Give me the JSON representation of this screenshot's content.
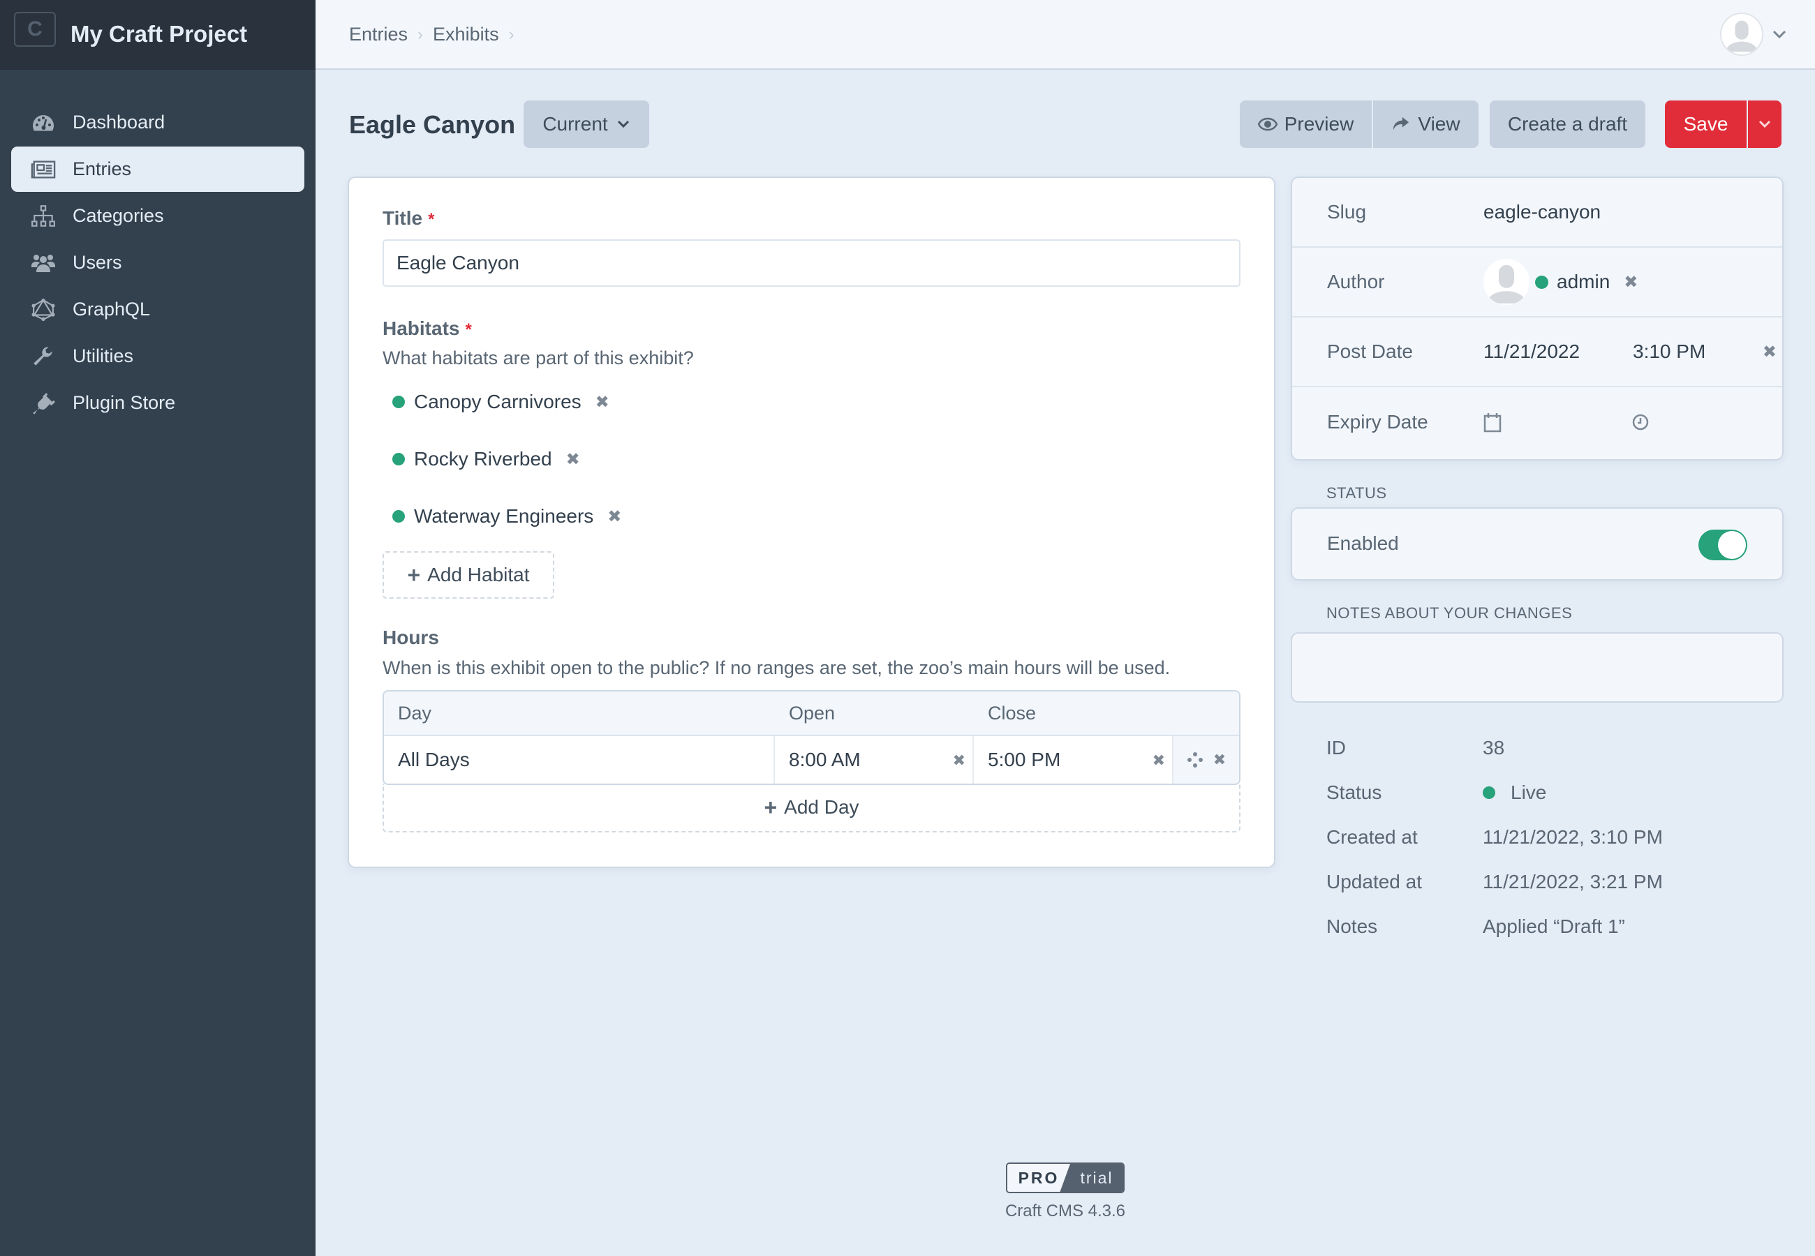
{
  "app": {
    "site_name": "My Craft Project",
    "logo_letter": "C"
  },
  "sidebar": {
    "items": [
      {
        "label": "Dashboard",
        "icon": "gauge-icon",
        "active": false
      },
      {
        "label": "Entries",
        "icon": "newspaper-icon",
        "active": true
      },
      {
        "label": "Categories",
        "icon": "sitemap-icon",
        "active": false
      },
      {
        "label": "Users",
        "icon": "users-icon",
        "active": false
      },
      {
        "label": "GraphQL",
        "icon": "graphql-icon",
        "active": false
      },
      {
        "label": "Utilities",
        "icon": "wrench-icon",
        "active": false
      },
      {
        "label": "Plugin Store",
        "icon": "plug-icon",
        "active": false
      }
    ]
  },
  "header": {
    "breadcrumbs": [
      "Entries",
      "Exhibits"
    ],
    "breadcrumb_separator": "›"
  },
  "page": {
    "title": "Eagle Canyon",
    "revision_label": "Current",
    "buttons": {
      "preview": "Preview",
      "view": "View",
      "create_draft": "Create a draft",
      "save": "Save"
    }
  },
  "form": {
    "title_field": {
      "label": "Title",
      "required_marker": "*",
      "value": "Eagle Canyon"
    },
    "habitats": {
      "label": "Habitats",
      "required_marker": "*",
      "instructions": "What habitats are part of this exhibit?",
      "items": [
        {
          "label": "Canopy Carnivores",
          "status": "enabled"
        },
        {
          "label": "Rocky Riverbed",
          "status": "enabled"
        },
        {
          "label": "Waterway Engineers",
          "status": "enabled"
        }
      ],
      "remove_glyph": "✖",
      "add_label": "Add Habitat"
    },
    "hours": {
      "label": "Hours",
      "instructions": "When is this exhibit open to the public? If no ranges are set, the zoo’s main hours will be used.",
      "columns": [
        "Day",
        "Open",
        "Close"
      ],
      "rows": [
        {
          "day": "All Days",
          "open": "8:00 AM",
          "close": "5:00 PM"
        }
      ],
      "add_label": "Add Day"
    }
  },
  "meta": {
    "slug": {
      "label": "Slug",
      "value": "eagle-canyon"
    },
    "author": {
      "label": "Author",
      "value": "admin"
    },
    "post_date": {
      "label": "Post Date",
      "date": "11/21/2022",
      "time": "3:10 PM"
    },
    "expiry_date": {
      "label": "Expiry Date",
      "date": "",
      "time": ""
    }
  },
  "status_section": {
    "heading": "STATUS",
    "enabled_label": "Enabled",
    "enabled": true
  },
  "notes_section": {
    "heading": "NOTES ABOUT YOUR CHANGES",
    "value": ""
  },
  "info": [
    {
      "label": "ID",
      "value": "38"
    },
    {
      "label": "Status",
      "value": "Live"
    },
    {
      "label": "Created at",
      "value": "11/21/2022, 3:10 PM"
    },
    {
      "label": "Updated at",
      "value": "11/21/2022, 3:21 PM"
    },
    {
      "label": "Notes",
      "value": "Applied “Draft 1”"
    }
  ],
  "footer": {
    "edition": "PRO",
    "edition_status": "trial",
    "version": "Craft CMS 4.3.6"
  },
  "colors": {
    "accent_red": "#e12d39",
    "status_green": "#27a27a",
    "sidebar_bg": "#33404d"
  }
}
